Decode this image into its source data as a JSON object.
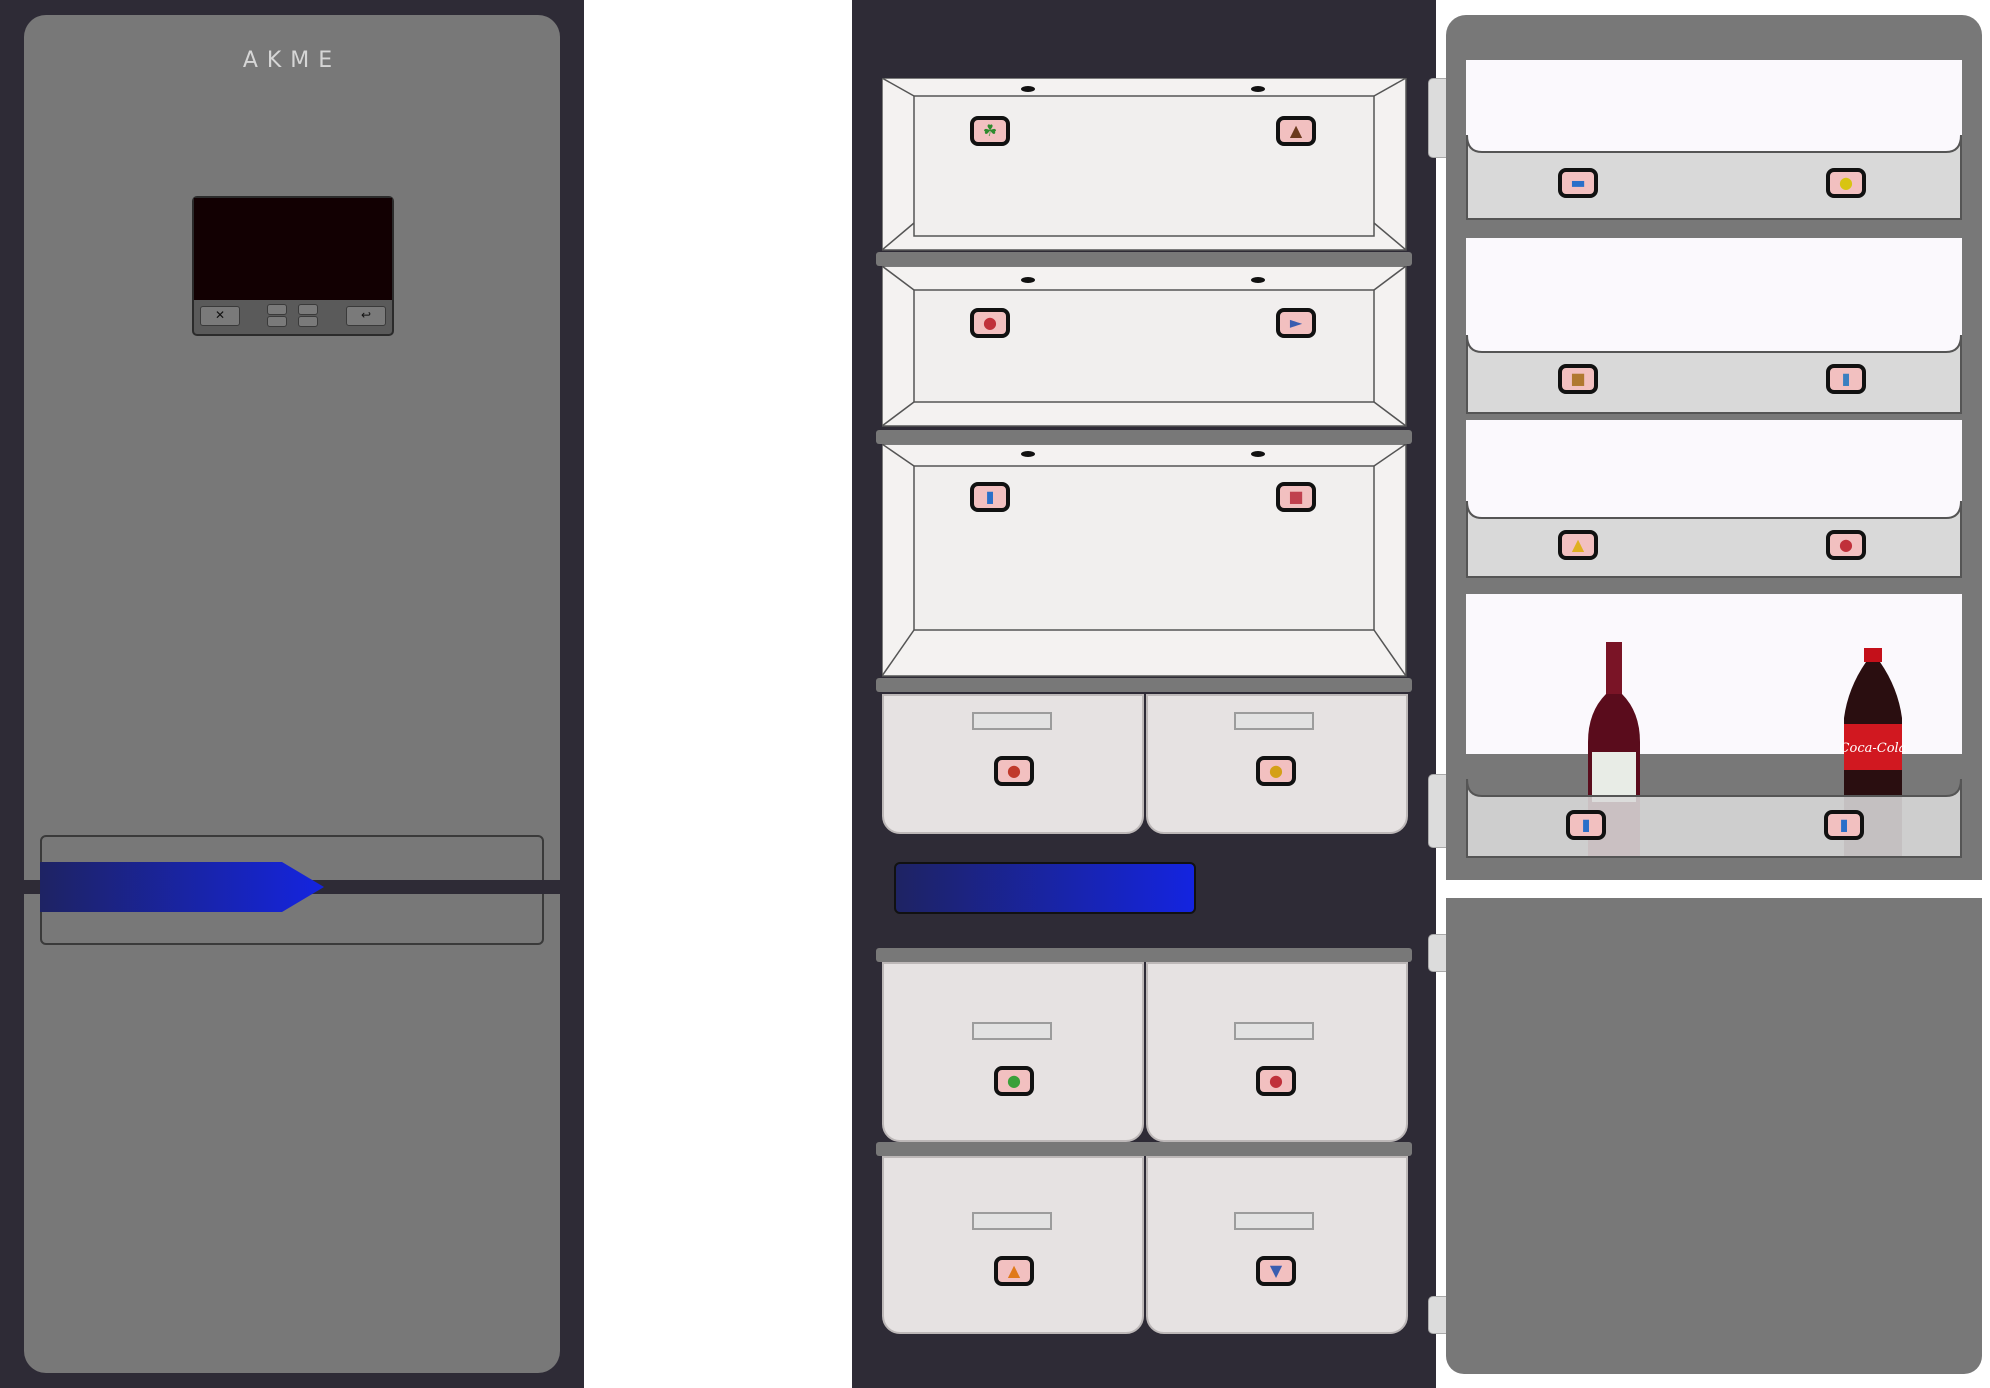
{
  "closed_fridge": {
    "brand": "AKME",
    "control_panel": {
      "buttons": [
        "✕",
        "↩"
      ]
    }
  },
  "open_fridge": {
    "shelves": [
      {
        "left_icon": "broccoli-icon",
        "right_icon": "mushroom-icon"
      },
      {
        "left_icon": "steak-icon",
        "right_icon": "fish-icon"
      },
      {
        "left_icon": "milk-icon",
        "right_icon": "cake-icon"
      }
    ],
    "upper_drawers": [
      {
        "icon": "vegetables-icon"
      },
      {
        "icon": "fruits-icon"
      }
    ],
    "freezer_drawers": [
      {
        "icon": "frozen-vegetables-icon"
      },
      {
        "icon": "frozen-meat-icon"
      },
      {
        "icon": "frozen-snacks-icon"
      },
      {
        "icon": "ice-cream-icon"
      }
    ]
  },
  "door": {
    "trays": [
      {
        "left_icon": "canned-food-icon",
        "right_icon": "lemon-icon"
      },
      {
        "left_icon": "bread-icon",
        "right_icon": "jam-icon"
      },
      {
        "left_icon": "cheese-icon",
        "right_icon": "ham-icon"
      },
      {
        "left_icon": "wine-bottle-icon",
        "right_icon": "soda-bottle-icon"
      }
    ],
    "bottles": {
      "right_label": "Coca-Cola"
    }
  },
  "colors": {
    "cabinet": "#2e2b36",
    "door": "#787878",
    "interior": "#f4f2f1",
    "drawer": "#e6e2e2",
    "handle_gradient_start": "#1e2363",
    "handle_gradient_end": "#1424e0",
    "icon_badge": "#f2c0c0",
    "screen": "#120002"
  }
}
